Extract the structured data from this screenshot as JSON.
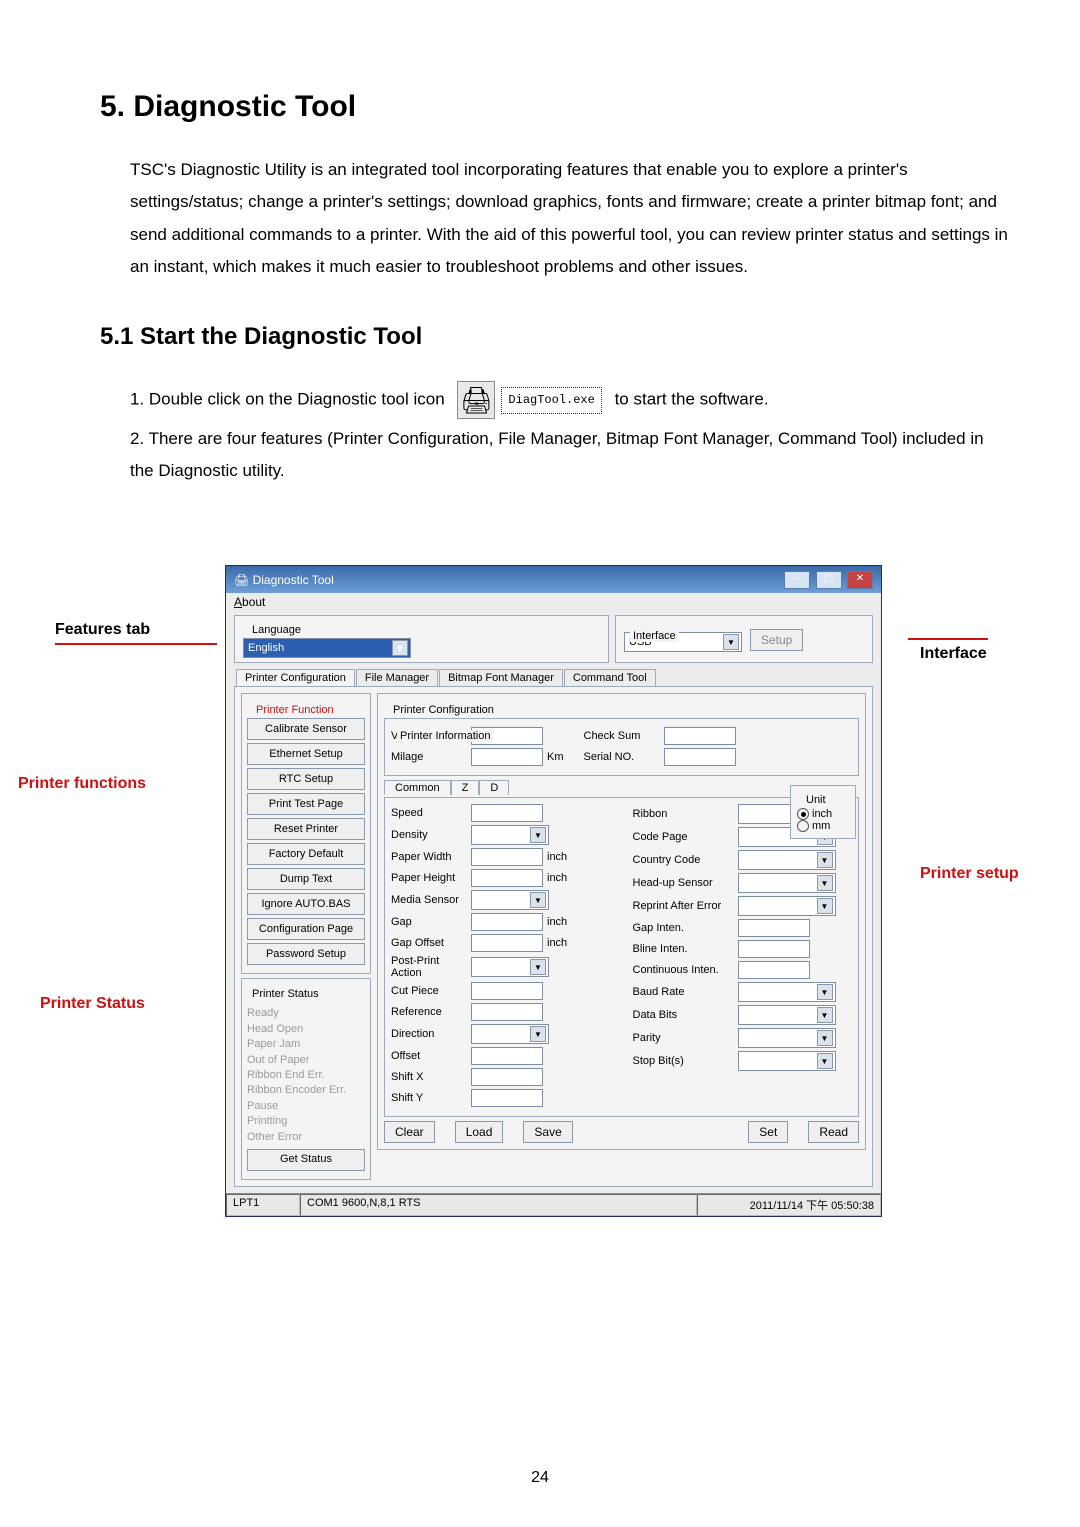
{
  "heading": "5. Diagnostic Tool",
  "intro": "TSC's Diagnostic Utility is an integrated tool incorporating features that enable you to explore a printer's settings/status; change a printer's settings; download graphics, fonts and firmware; create a printer bitmap font; and send additional commands to a printer. With the aid of this powerful tool, you can review printer status and settings in an instant, which makes it much easier to troubleshoot problems and other issues.",
  "sub_heading": "5.1 Start the Diagnostic Tool",
  "step1_a": "1. Double click on the Diagnostic tool icon",
  "step1_b": "to start the software.",
  "icon_label": "DiagTool.exe",
  "step2": "2. There are four features (Printer Configuration, File Manager, Bitmap Font Manager, Command Tool) included in the Diagnostic utility.",
  "callouts": {
    "features": "Features tab",
    "functions": "Printer functions",
    "status": "Printer Status",
    "interface": "Interface",
    "setup": "Printer setup"
  },
  "win": {
    "title": "Diagnostic Tool",
    "menu": "About",
    "language_title": "Language",
    "language_value": "English",
    "interface_title": "Interface",
    "interface_value": "USB",
    "setup_btn": "Setup",
    "tabs": [
      "Printer Configuration",
      "File Manager",
      "Bitmap Font Manager",
      "Command Tool"
    ],
    "pf_title": "Printer Function",
    "pf_btns": [
      "Calibrate Sensor",
      "Ethernet Setup",
      "RTC Setup",
      "Print Test Page",
      "Reset Printer",
      "Factory Default",
      "Dump Text",
      "Ignore AUTO.BAS",
      "Configuration Page",
      "Password Setup"
    ],
    "ps_title": "Printer Status",
    "ps_items": [
      "Ready",
      "Head Open",
      "Paper Jam",
      "Out of Paper",
      "Ribbon End Err.",
      "Ribbon Encoder Err.",
      "Pause",
      "Printting",
      "Other Error"
    ],
    "ps_btn": "Get Status",
    "cfg_title": "Printer Configuration",
    "info_title": "Printer Information",
    "info_left": {
      "Version": "Version",
      "Milage": "Milage",
      "Km": "Km"
    },
    "info_right": {
      "CheckSum": "Check Sum",
      "SerialNO": "Serial NO."
    },
    "unit_title": "Unit",
    "unit_inch": "inch",
    "unit_mm": "mm",
    "subtabs": [
      "Common",
      "Z",
      "D"
    ],
    "left_fields": [
      "Speed",
      "Density",
      "Paper Width",
      "Paper Height",
      "Media Sensor",
      "Gap",
      "Gap Offset",
      "Post-Print Action",
      "Cut Piece",
      "Reference",
      "Direction",
      "Offset",
      "Shift X",
      "Shift Y"
    ],
    "left_units": [
      "",
      "",
      "inch",
      "inch",
      "",
      "inch",
      "inch",
      "",
      "",
      "",
      "",
      "",
      "",
      ""
    ],
    "right_fields": [
      "Ribbon",
      "Code Page",
      "Country Code",
      "Head-up Sensor",
      "Reprint After Error",
      "Gap Inten.",
      "Bline Inten.",
      "Continuous Inten.",
      "Baud Rate",
      "Data Bits",
      "Parity",
      "Stop Bit(s)"
    ],
    "btns": {
      "clear": "Clear",
      "load": "Load",
      "save": "Save",
      "set": "Set",
      "read": "Read"
    },
    "status_lpt": "LPT1",
    "status_com": "COM1 9600,N,8,1 RTS",
    "status_time": "2011/11/14 下午 05:50:38"
  },
  "page_number": "24"
}
